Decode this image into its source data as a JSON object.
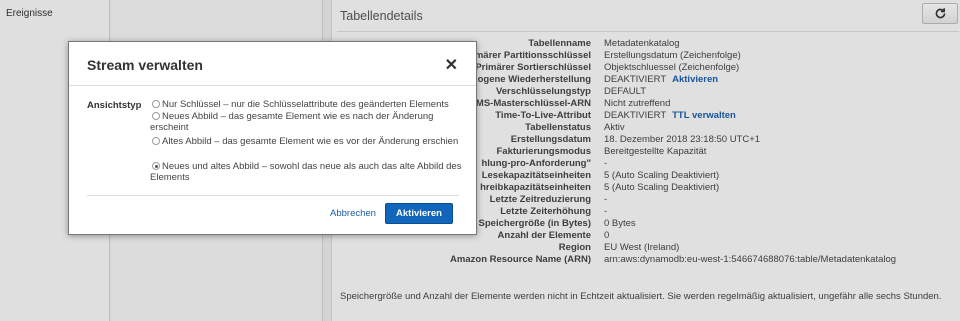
{
  "nav": {
    "events": "Ereignisse"
  },
  "details": {
    "title": "Tabellendetails",
    "refresh_icon": "refresh-icon",
    "rows": [
      {
        "key": "Tabellenname",
        "value": "Metadatenkatalog"
      },
      {
        "key": "rimärer Partitionsschlüssel",
        "value": "Erstellungsdatum (Zeichenfolge)"
      },
      {
        "key": "Primärer Sortierschlüssel",
        "value": "Objektschluessel (Zeichenfolge)"
      },
      {
        "key": "gogene Wiederherstellung",
        "value": "DEAKTIVIERT",
        "link": "Aktivieren"
      },
      {
        "key": "Verschlüsselungstyp",
        "value": "DEFAULT"
      },
      {
        "key": "MS-Masterschlüssel-ARN",
        "value": "Nicht zutreffend"
      },
      {
        "key": "Time-To-Live-Attribut",
        "value": "DEAKTIVIERT",
        "link": "TTL verwalten"
      },
      {
        "key": "Tabellenstatus",
        "value": "Aktiv"
      },
      {
        "key": "Erstellungsdatum",
        "value": "18. Dezember 2018 23:18:50 UTC+1"
      },
      {
        "key": "Fakturierungsmodus",
        "value": "Bereitgestellte Kapazität"
      },
      {
        "key": "hlung-pro-Anforderung\"",
        "value": "-"
      },
      {
        "key": "Lesekapazitätseinheiten",
        "value": "5 (Auto Scaling Deaktiviert)"
      },
      {
        "key": "hreibkapazitätseinheiten",
        "value": "5 (Auto Scaling Deaktiviert)"
      },
      {
        "key": "Letzte Zeitreduzierung",
        "value": "-"
      },
      {
        "key": "Letzte Zeiterhöhung",
        "value": "-"
      },
      {
        "key": "Speichergröße (in Bytes)",
        "value": "0 Bytes"
      },
      {
        "key": "Anzahl der Elemente",
        "value": "0"
      },
      {
        "key": "Region",
        "value": "EU West (Ireland)"
      },
      {
        "key": "Amazon Resource Name (ARN)",
        "value": "arn:aws:dynamodb:eu-west-1:546674688076:table/Metadatenkatalog"
      }
    ],
    "footnote": "Speichergröße und Anzahl der Elemente werden nicht in Echtzeit aktualisiert. Sie werden regelmäßig aktualisiert, ungefähr alle sechs Stunden."
  },
  "modal": {
    "title": "Stream verwalten",
    "close_icon": "close-icon",
    "field_label": "Ansichtstyp",
    "options": [
      {
        "label": "Nur Schlüssel – nur die Schlüsselattribute des geänderten Elements",
        "checked": false
      },
      {
        "label": "Neues Abbild – das gesamte Element wie es nach der Änderung erscheint",
        "checked": false
      },
      {
        "label": "Altes Abbild – das gesamte Element wie es vor der Änderung erschien",
        "checked": false
      },
      {
        "label": "Neues und altes Abbild – sowohl das neue als auch das alte Abbild des Elements",
        "checked": true
      }
    ],
    "cancel_label": "Abbrechen",
    "activate_label": "Aktivieren"
  },
  "colors": {
    "link": "#1b5ea8",
    "primary_button": "#1166bb"
  }
}
